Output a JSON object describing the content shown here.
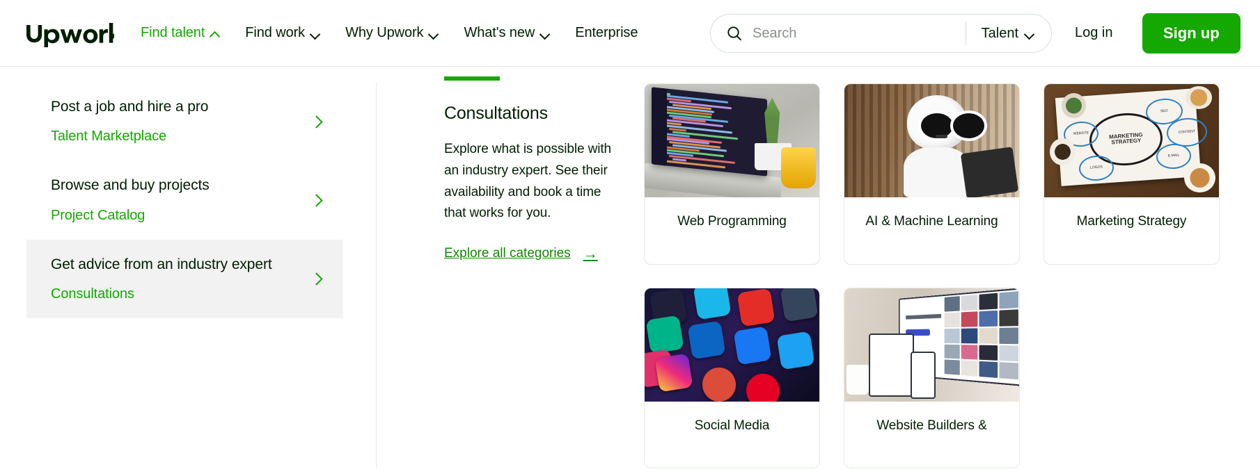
{
  "header": {
    "logo_alt": "upwork",
    "nav": [
      {
        "label": "Find talent",
        "icon": "chevron-up-icon",
        "active": true
      },
      {
        "label": "Find work",
        "icon": "chevron-down-icon",
        "active": false
      },
      {
        "label": "Why Upwork",
        "icon": "chevron-down-icon",
        "active": false
      },
      {
        "label": "What's new",
        "icon": "chevron-down-icon",
        "active": false
      },
      {
        "label": "Enterprise",
        "icon": "",
        "active": false
      }
    ],
    "search": {
      "placeholder": "Search",
      "value": "",
      "icon": "search-icon",
      "scope_label": "Talent",
      "scope_icon": "chevron-down-icon"
    },
    "login_label": "Log in",
    "signup_label": "Sign up"
  },
  "sidebar": {
    "items": [
      {
        "title": "Post a job and hire a pro",
        "subtitle": "Talent Marketplace",
        "selected": false
      },
      {
        "title": "Browse and buy projects",
        "subtitle": "Project Catalog",
        "selected": false
      },
      {
        "title": "Get advice from an industry expert",
        "subtitle": "Consultations",
        "selected": true
      }
    ]
  },
  "panel": {
    "title": "Consultations",
    "description": "Explore what is possible with an industry expert. See their availability and book a time that works for you.",
    "explore_label": "Explore all categories",
    "explore_arrow": "arrow-right-icon",
    "cards": [
      {
        "label": "Web Programming",
        "art": "code"
      },
      {
        "label": "AI & Machine Learning",
        "art": "robot"
      },
      {
        "label": "Marketing Strategy",
        "art": "marketing"
      },
      {
        "label": "Social Media",
        "art": "social"
      },
      {
        "label": "Website Builders &",
        "art": "web"
      }
    ]
  },
  "colors": {
    "brand_green": "#14a800",
    "link_green": "#108a00",
    "text": "#001e00",
    "selected_bg": "#f2f2f2",
    "border": "#e4ebe4"
  }
}
